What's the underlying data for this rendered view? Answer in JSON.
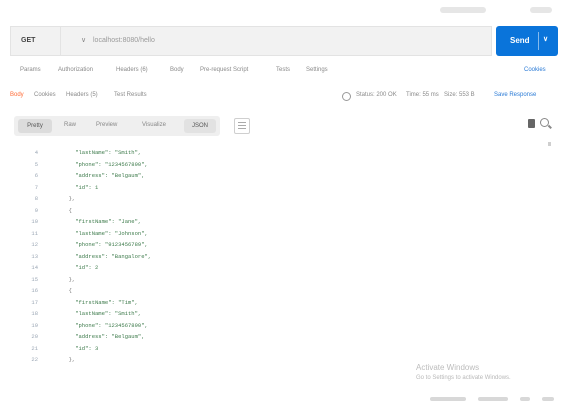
{
  "request": {
    "method": "GET",
    "url": "localhost:8080/hello",
    "send_label": "Send"
  },
  "param_tabs": [
    "Params",
    "Authorization",
    "Headers (6)",
    "Body",
    "Pre-request Script",
    "Tests",
    "Settings"
  ],
  "cookies_label": "Cookies",
  "response_tabs": [
    "Body",
    "Cookies",
    "Headers (5)",
    "Test Results"
  ],
  "status": {
    "status": "Status: 200 OK",
    "time": "Time: 55 ms",
    "size": "Size: 553 B",
    "save_label": "Save Response"
  },
  "view_modes": [
    "Pretty",
    "Raw",
    "Preview",
    "Visualize"
  ],
  "format": "JSON",
  "code_lines": [
    {
      "n": "4",
      "t": "    \"lastName\": \"Smith\","
    },
    {
      "n": "5",
      "t": "    \"phone\": \"1234567890\","
    },
    {
      "n": "6",
      "t": "    \"address\": \"Belgaum\","
    },
    {
      "n": "7",
      "t": "    \"id\": 1"
    },
    {
      "n": "8",
      "t": "  },"
    },
    {
      "n": "9",
      "t": "  {"
    },
    {
      "n": "10",
      "t": "    \"firstName\": \"Jane\","
    },
    {
      "n": "11",
      "t": "    \"lastName\": \"Johnson\","
    },
    {
      "n": "12",
      "t": "    \"phone\": \"9123456789\","
    },
    {
      "n": "13",
      "t": "    \"address\": \"Bangalore\","
    },
    {
      "n": "14",
      "t": "    \"id\": 2"
    },
    {
      "n": "15",
      "t": "  },"
    },
    {
      "n": "16",
      "t": "  {"
    },
    {
      "n": "17",
      "t": "    \"firstName\": \"Tim\","
    },
    {
      "n": "18",
      "t": "    \"lastName\": \"Smith\","
    },
    {
      "n": "19",
      "t": "    \"phone\": \"1234567890\","
    },
    {
      "n": "20",
      "t": "    \"address\": \"Belgaum\","
    },
    {
      "n": "21",
      "t": "    \"id\": 3"
    },
    {
      "n": "22",
      "t": "  },"
    }
  ],
  "watermark": {
    "line1": "Activate Windows",
    "line2": "Go to Settings to activate Windows."
  },
  "colors": {
    "accent": "#0a74da",
    "active_tab": "#ff6c37",
    "link": "#2b7bd6",
    "string": "#3c7a4a"
  }
}
